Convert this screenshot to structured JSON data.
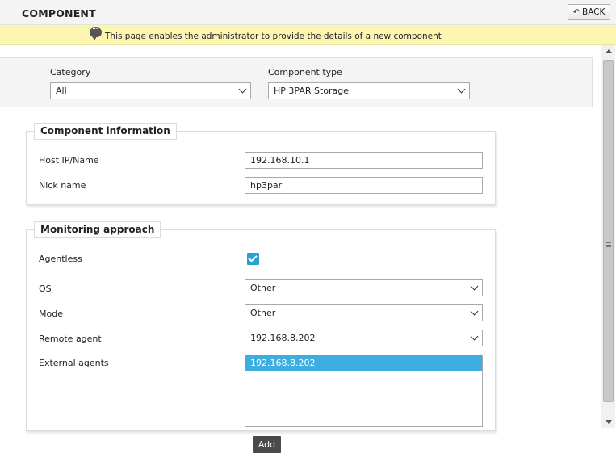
{
  "header": {
    "title": "COMPONENT",
    "back_label": "BACK"
  },
  "info_bar": {
    "message": "This page enables the administrator to provide the details of a new component"
  },
  "filters": {
    "category_label": "Category",
    "category_value": "All",
    "component_type_label": "Component type",
    "component_type_value": "HP 3PAR Storage"
  },
  "component_info": {
    "legend": "Component information",
    "host_label": "Host IP/Name",
    "host_value": "192.168.10.1",
    "nick_label": "Nick name",
    "nick_value": "hp3par"
  },
  "monitoring": {
    "legend": "Monitoring approach",
    "agentless_label": "Agentless",
    "agentless_checked": true,
    "os_label": "OS",
    "os_value": "Other",
    "mode_label": "Mode",
    "mode_value": "Other",
    "remote_agent_label": "Remote agent",
    "remote_agent_value": "192.168.8.202",
    "external_agents_label": "External agents",
    "external_agents": [
      "192.168.8.202"
    ]
  },
  "actions": {
    "add_label": "Add"
  },
  "colors": {
    "info_bar_bg": "#fcf6b2",
    "selection_blue": "#3eaee0",
    "checkbox_blue": "#2a9fd6",
    "add_button_bg": "#4a4a4a"
  }
}
